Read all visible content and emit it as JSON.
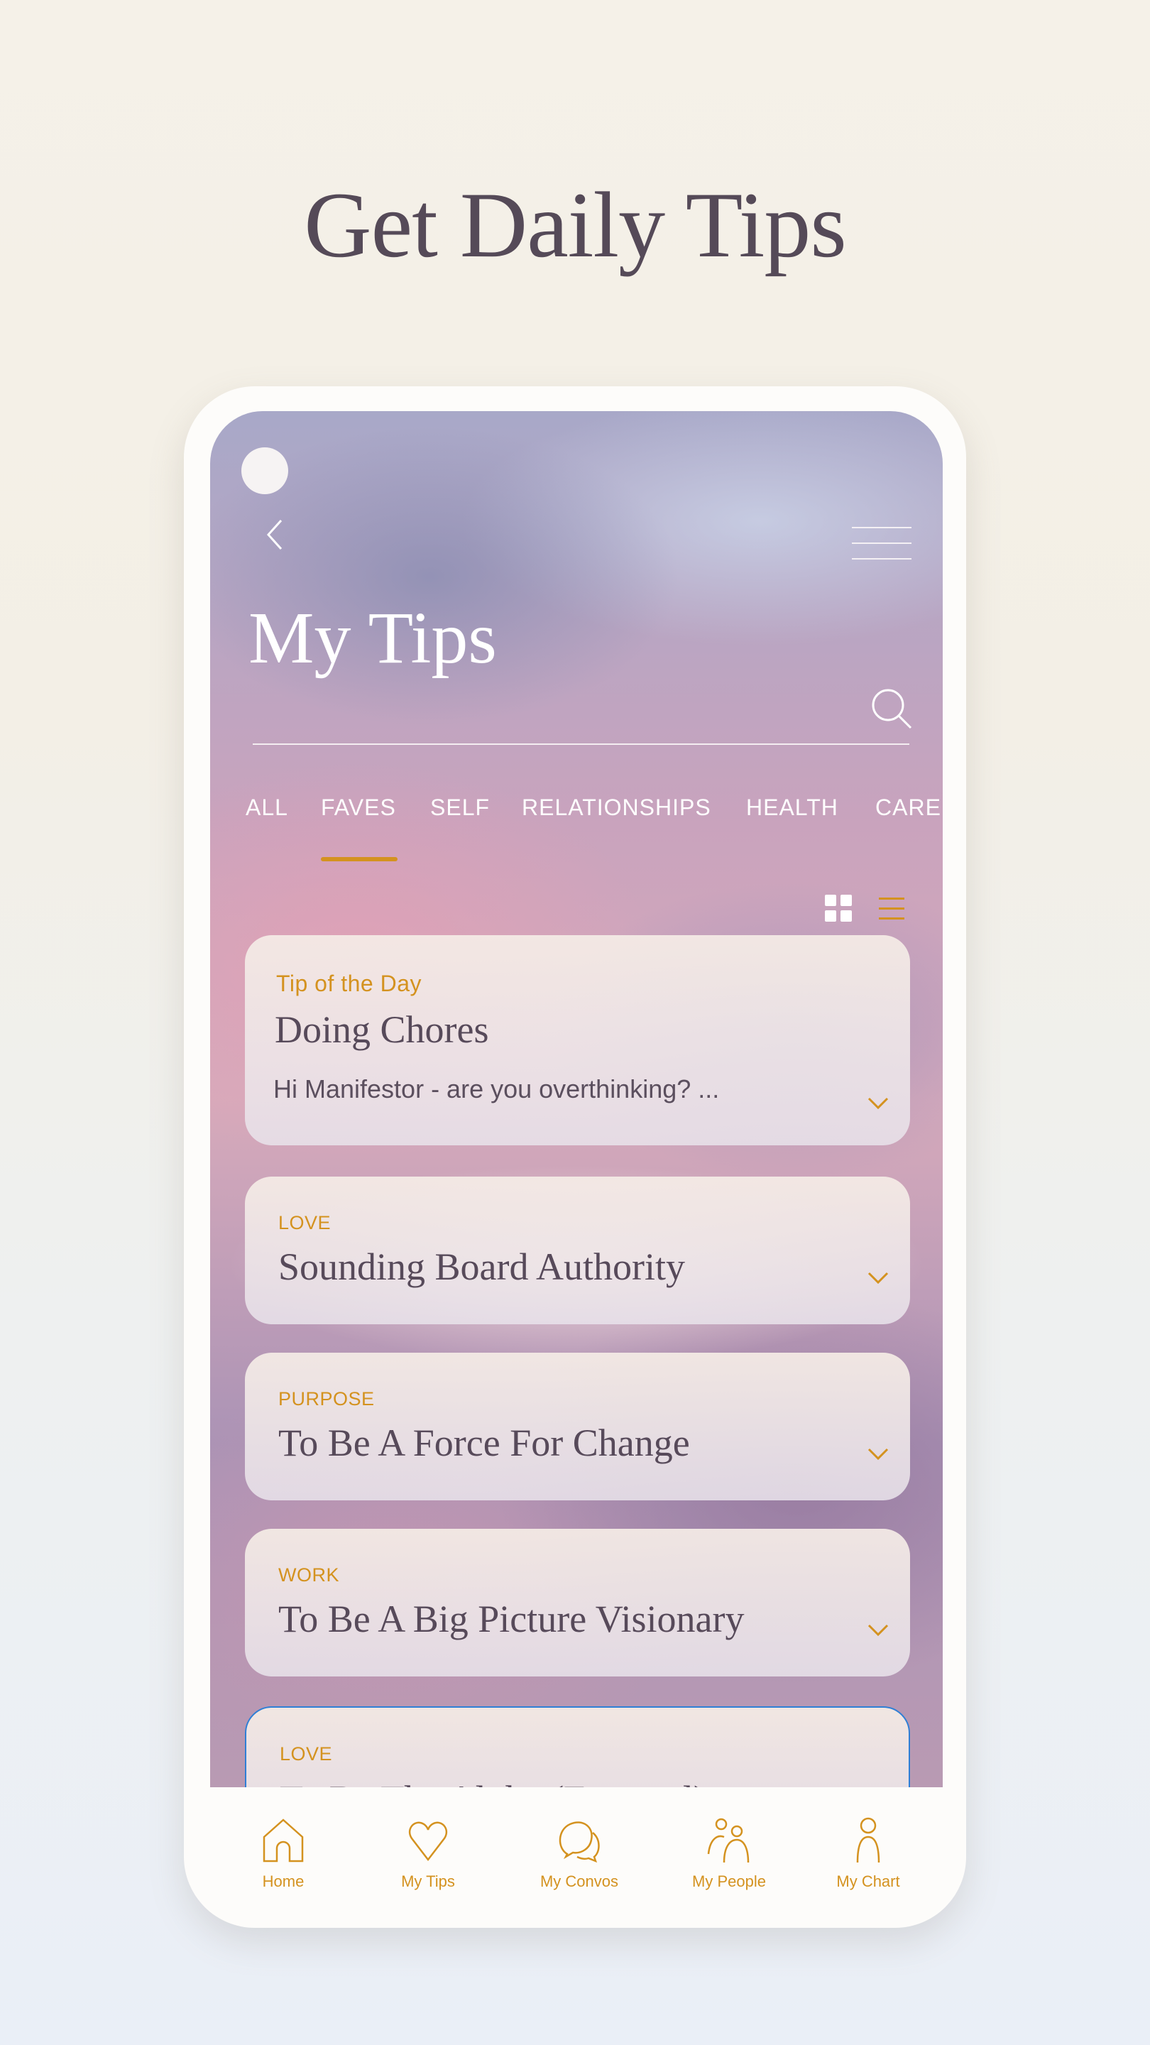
{
  "headline": "Get Daily Tips",
  "header": {
    "title": "My Tips",
    "search_placeholder": ""
  },
  "tabs": [
    {
      "label": "ALL",
      "active": false
    },
    {
      "label": "FAVES",
      "active": true
    },
    {
      "label": "SELF",
      "active": false
    },
    {
      "label": "RELATIONSHIPS",
      "active": false
    },
    {
      "label": "HEALTH",
      "active": false
    },
    {
      "label": "CARE",
      "active": false
    }
  ],
  "view_toggle": {
    "grid_icon": "grid-icon",
    "list_icon": "list-icon",
    "active": "list"
  },
  "cards": [
    {
      "category": "Tip of the Day",
      "title": "Doing Chores",
      "body": "Hi Manifestor - are you overthinking? ..."
    },
    {
      "category": "LOVE",
      "title": "Sounding Board Authority"
    },
    {
      "category": "PURPOSE",
      "title": "To Be A Force For Change"
    },
    {
      "category": "WORK",
      "title": "To Be A Big Picture Visionary"
    },
    {
      "category": "LOVE",
      "title": "To Be The Alpha (External)"
    }
  ],
  "nav": [
    {
      "label": "Home",
      "icon": "home-icon"
    },
    {
      "label": "My Tips",
      "icon": "heart-icon"
    },
    {
      "label": "My Convos",
      "icon": "chat-icon"
    },
    {
      "label": "My People",
      "icon": "people-icon"
    },
    {
      "label": "My Chart",
      "icon": "person-icon"
    }
  ],
  "colors": {
    "accent": "#d4921f",
    "headline": "#554a58",
    "card_text": "#574a5a",
    "selected_outline": "#2f7fd6"
  }
}
